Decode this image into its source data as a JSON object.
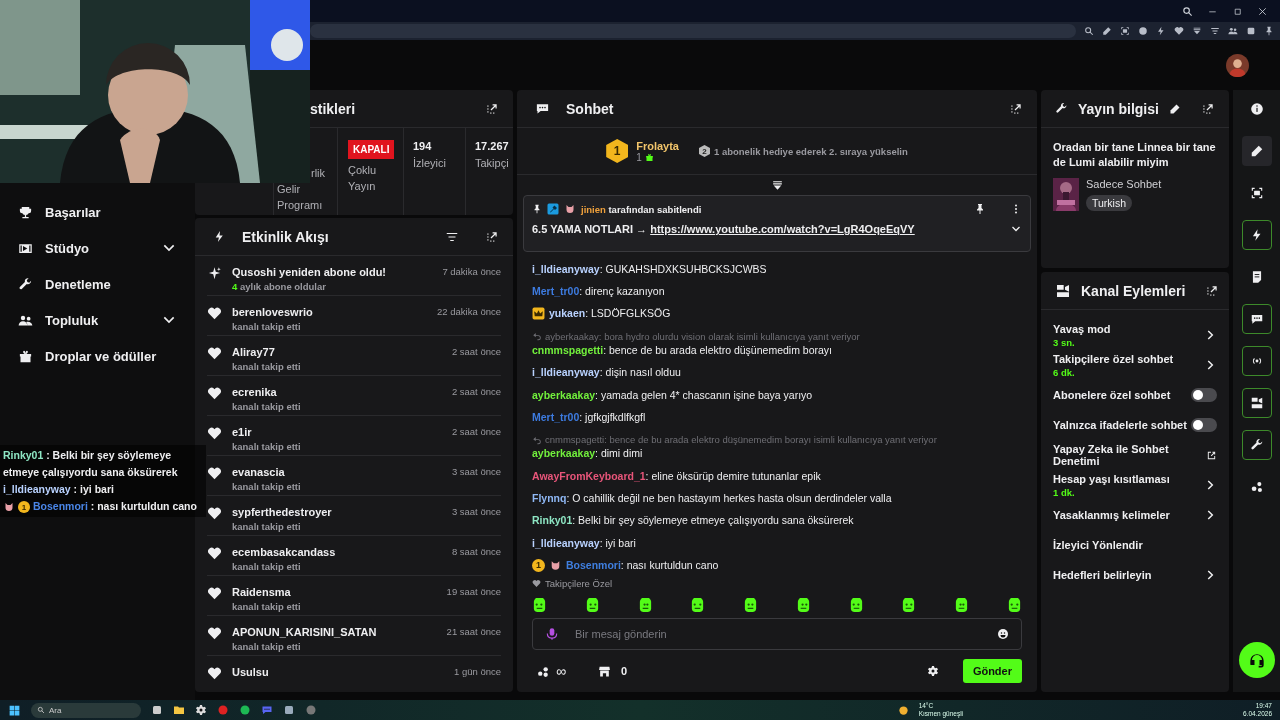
{
  "overlay_chat": [
    {
      "user": "Rinky01",
      "color": "#8ee6c4",
      "text": " : Belki bir şey söylemeye etmeye çalışıyordu sana öksürerek"
    },
    {
      "user": "i_lldieanyway",
      "color": "#b9d2ff",
      "text": " : iyi bari"
    },
    {
      "user": "Bosenmori",
      "color": "#4a86e8",
      "rank_badge": "1",
      "text": " : nası kurtuldun cano"
    }
  ],
  "sidebar": {
    "items": [
      {
        "label": "Başarılar",
        "has_submenu": false
      },
      {
        "label": "Stüdyo",
        "has_submenu": true
      },
      {
        "label": "Denetleme",
        "has_submenu": false
      },
      {
        "label": "Topluluk",
        "has_submenu": true
      },
      {
        "label": "Droplar ve ödüller",
        "has_submenu": false
      }
    ]
  },
  "stats": {
    "title": "stikleri",
    "cells": [
      {
        "kind": "label",
        "label_top": "rlik",
        "label": "Gelir Programı"
      },
      {
        "kind": "badge",
        "badge": "KAPALI",
        "label": "Çoklu Yayın"
      },
      {
        "kind": "value",
        "value": "194",
        "label": "İzleyici"
      },
      {
        "kind": "value",
        "value": "17.267",
        "label": "Takipçi"
      }
    ]
  },
  "activity": {
    "title": "Etkinlik Akışı",
    "events": [
      {
        "kind": "resub",
        "title": "Qusoshi yeniden abone oldu!",
        "detail": "**4** aylık abone oldular",
        "time": "7 dakika önce"
      },
      {
        "kind": "follow",
        "title": "berenloveswrio",
        "detail": "kanalı takip etti",
        "time": "22 dakika önce"
      },
      {
        "kind": "follow",
        "title": "Aliray77",
        "detail": "kanalı takip etti",
        "time": "2 saat önce"
      },
      {
        "kind": "follow",
        "title": "ecrenika",
        "detail": "kanalı takip etti",
        "time": "2 saat önce"
      },
      {
        "kind": "follow",
        "title": "e1ir",
        "detail": "kanalı takip etti",
        "time": "2 saat önce"
      },
      {
        "kind": "follow",
        "title": "evanascia",
        "detail": "kanalı takip etti",
        "time": "3 saat önce"
      },
      {
        "kind": "follow",
        "title": "sypferthedestroyer",
        "detail": "kanalı takip etti",
        "time": "3 saat önce"
      },
      {
        "kind": "follow",
        "title": "ecembasakcandass",
        "detail": "kanalı takip etti",
        "time": "8 saat önce"
      },
      {
        "kind": "follow",
        "title": "Raidensma",
        "detail": "kanalı takip etti",
        "time": "19 saat önce"
      },
      {
        "kind": "follow",
        "title": "APONUN_KARISINI_SATAN",
        "detail": "kanalı takip etti",
        "time": "21 saat önce"
      },
      {
        "kind": "follow",
        "title": "Usulsu",
        "time": "1 gün önce"
      }
    ]
  },
  "chat": {
    "title": "Sohbet",
    "leader": {
      "rank": "1",
      "name": "Frolayta",
      "count": "1",
      "next_rank": "2",
      "prompt": "1 abonelik hediye ederek 2. sıraya yükselin"
    },
    "pinned": {
      "by": "jinien",
      "note": "tarafından sabitlendi",
      "text": "6.5 YAMA NOTLARI → ",
      "link": "https://www.youtube.com/watch?v=LgR4OqeEqVY"
    },
    "messages": [
      {
        "user": "i_lldieanyway",
        "color": "#b9d2ff",
        "text": ": GUKAHSHDXKSUHBCKSJCWBS"
      },
      {
        "user": "Mert_tr00",
        "color": "#3d7be0",
        "text": ": direnç kazanıyon"
      },
      {
        "user": "yukaen",
        "color": "#b9d2ff",
        "text": ": LSDÖFGLKSÖG"
      },
      {
        "user": "cnmmspagetti",
        "color": "#72f03c",
        "reply_to": "ayberkaakay: bora hydro olurdu vision olarak isimli kullanıcıya yanıt veriyor",
        "text": ": bence de bu arada elektro düşünemedim borayı"
      },
      {
        "user": "i_lldieanyway",
        "color": "#b9d2ff",
        "text": ": dişin nasıl olduu"
      },
      {
        "user": "ayberkaakay",
        "color": "#72f03c",
        "text": ": yamada gelen 4* chascanın işine baya yarıyo"
      },
      {
        "user": "Mert_tr00",
        "color": "#3d7be0",
        "text": ": jgfkgjfkdlfkgfl"
      },
      {
        "user": "ayberkaakay",
        "color": "#72f03c",
        "reply_to": "cnmmspagetti: bence de bu arada elektro düşünemedim borayı isimli kullanıcıya yanıt veriyor",
        "text": ": dimi dimi"
      },
      {
        "user": "AwayFromKeyboard_1",
        "color": "#e8557a",
        "text": ": eline öksürüp demire tutunanlar epik"
      },
      {
        "user": "Flynnq",
        "color": "#8fb8f5",
        "text": ": O cahillik değil ne ben hastayım herkes hasta olsun derdindeler valla"
      },
      {
        "user": "Rinky01",
        "color": "#8ee6c4",
        "text": ": Belki bir şey söylemeye etmeye çalışıyordu sana öksürerek"
      },
      {
        "user": "i_lldieanyway",
        "color": "#b9d2ff",
        "text": ": iyi bari"
      },
      {
        "user": "Bosenmori",
        "color": "#3f7fe0",
        "rank_badge": "1",
        "text": ": nası kurtuldun cano"
      }
    ],
    "emote_section": "Takipçilere Özel",
    "input": {
      "placeholder": "Bir mesaj gönderin"
    },
    "points": "∞",
    "store_count": "0",
    "send": "Gönder"
  },
  "info": {
    "title": "Yayın bilgisi",
    "stream_title": "Oradan bir tane Linnea bir tane de Lumi alabilir miyim",
    "category": "Sadece Sohbet",
    "tags": [
      "Turkish"
    ]
  },
  "actions": {
    "title": "Kanal Eylemleri",
    "items": [
      {
        "kind": "nav",
        "label": "Yavaş mod",
        "value": "3 sn."
      },
      {
        "kind": "nav",
        "label": "Takipçilere özel sohbet",
        "value": "6 dk."
      },
      {
        "kind": "toggle",
        "label": "Abonelere özel sohbet",
        "on": false
      },
      {
        "kind": "toggle",
        "label": "Yalnızca ifadelerle sohbet",
        "on": false
      },
      {
        "kind": "external",
        "label": "Yapay Zeka ile Sohbet Denetimi"
      },
      {
        "kind": "nav",
        "label": "Hesap yaşı kısıtlaması",
        "value": "1 dk."
      },
      {
        "kind": "nav",
        "label": "Yasaklanmış kelimeler"
      },
      {
        "kind": "plain",
        "label": "İzleyici Yönlendir"
      },
      {
        "kind": "nav",
        "label": "Hedefleri belirleyin"
      }
    ]
  },
  "rail": [
    {
      "selected": false,
      "active": false
    },
    {
      "selected": true,
      "active": false
    },
    {
      "selected": false,
      "active": false
    },
    {
      "selected": false,
      "active": true
    },
    {
      "selected": false,
      "active": false
    },
    {
      "selected": false,
      "active": true
    },
    {
      "selected": false,
      "active": true
    },
    {
      "selected": false,
      "active": true
    },
    {
      "selected": false,
      "active": true
    },
    {
      "selected": false,
      "active": false
    }
  ],
  "taskbar": {
    "search_placeholder": "Ara",
    "weather": {
      "temp": "14°C",
      "condition": "Kısmen güneşli"
    },
    "time": "19:47",
    "date": "6.04.2026"
  }
}
